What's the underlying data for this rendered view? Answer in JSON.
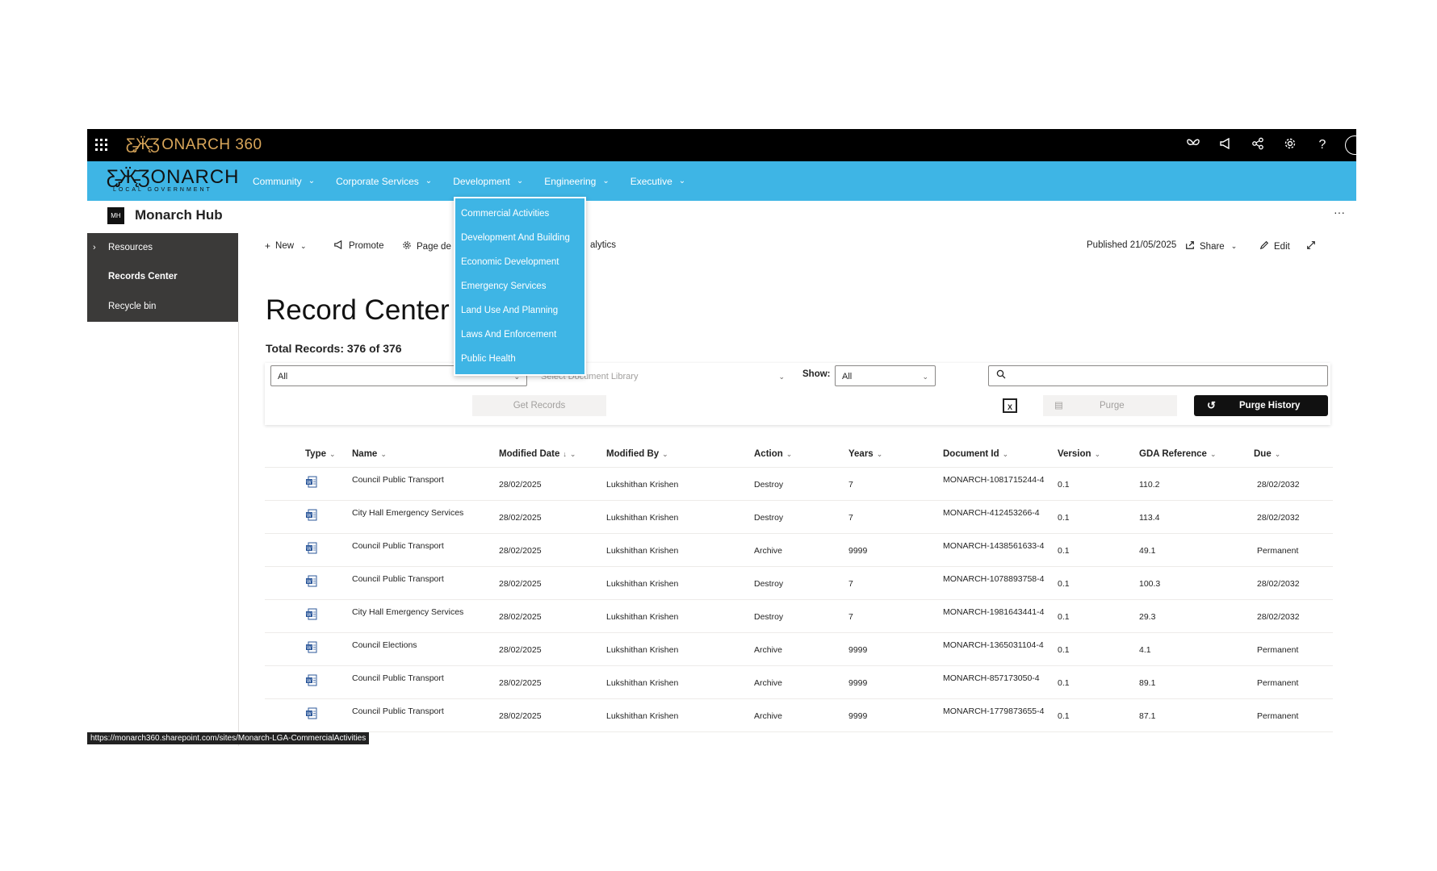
{
  "suitebar": {
    "brand": "ONARCH 360",
    "icons": [
      "monarch-butterfly-icon",
      "megaphone-icon",
      "share-network-icon",
      "gear-icon",
      "help-icon"
    ],
    "help_glyph": "?"
  },
  "hubnav": {
    "logo_word": "ONARCH",
    "logo_sub": "LOCAL GOVERNMENT",
    "items": [
      {
        "label": "Community"
      },
      {
        "label": "Corporate Services"
      },
      {
        "label": "Development"
      },
      {
        "label": "Engineering"
      },
      {
        "label": "Executive"
      }
    ],
    "dropdown": [
      {
        "label": "Commercial Activities"
      },
      {
        "label": "Development And Building"
      },
      {
        "label": "Economic Development"
      },
      {
        "label": "Emergency Services"
      },
      {
        "label": "Land Use And Planning"
      },
      {
        "label": "Laws And Enforcement"
      },
      {
        "label": "Public Health"
      }
    ]
  },
  "site": {
    "badge": "MH",
    "title": "Monarch Hub",
    "more": "···"
  },
  "leftnav": {
    "items": [
      {
        "label": "Resources"
      },
      {
        "label": "Records Center"
      },
      {
        "label": "Recycle bin"
      }
    ]
  },
  "commandbar": {
    "new_label": "New",
    "promote_label": "Promote",
    "page_details_label": "Page de",
    "analytics_label": "alytics",
    "published_label": "Published 21/05/2025",
    "share_label": "Share",
    "edit_label": "Edit"
  },
  "page": {
    "title": "Record Center",
    "total_records": "Total Records: 376 of 376"
  },
  "filters": {
    "site_select": "All",
    "library_placeholder": "Select Document Library",
    "show_label": "Show:",
    "show_value": "All",
    "get_records_label": "Get Records",
    "excel_label": "X",
    "purge_label": "Purge",
    "purge_history_label": "Purge History"
  },
  "table": {
    "columns": [
      "Type",
      "Name",
      "Modified Date",
      "Modified By",
      "Action",
      "Years",
      "Document Id",
      "Version",
      "GDA Reference",
      "Due"
    ],
    "sort_indicator": "↓",
    "rows": [
      {
        "name": "Council Public Transport",
        "modified": "28/02/2025",
        "by": "Lukshithan Krishen",
        "action": "Destroy",
        "years": "7",
        "doc_id": "MONARCH-1081715244-4",
        "version": "0.1",
        "gda": "110.2",
        "due": "28/02/2032"
      },
      {
        "name": "City Hall Emergency Services",
        "modified": "28/02/2025",
        "by": "Lukshithan Krishen",
        "action": "Destroy",
        "years": "7",
        "doc_id": "MONARCH-412453266-4",
        "version": "0.1",
        "gda": "113.4",
        "due": "28/02/2032"
      },
      {
        "name": "Council Public Transport",
        "modified": "28/02/2025",
        "by": "Lukshithan Krishen",
        "action": "Archive",
        "years": "9999",
        "doc_id": "MONARCH-1438561633-4",
        "version": "0.1",
        "gda": "49.1",
        "due": "Permanent"
      },
      {
        "name": "Council Public Transport",
        "modified": "28/02/2025",
        "by": "Lukshithan Krishen",
        "action": "Destroy",
        "years": "7",
        "doc_id": "MONARCH-1078893758-4",
        "version": "0.1",
        "gda": "100.3",
        "due": "28/02/2032"
      },
      {
        "name": "City Hall Emergency Services",
        "modified": "28/02/2025",
        "by": "Lukshithan Krishen",
        "action": "Destroy",
        "years": "7",
        "doc_id": "MONARCH-1981643441-4",
        "version": "0.1",
        "gda": "29.3",
        "due": "28/02/2032"
      },
      {
        "name": "Council Elections",
        "modified": "28/02/2025",
        "by": "Lukshithan Krishen",
        "action": "Archive",
        "years": "9999",
        "doc_id": "MONARCH-1365031104-4",
        "version": "0.1",
        "gda": "4.1",
        "due": "Permanent"
      },
      {
        "name": "Council Public Transport",
        "modified": "28/02/2025",
        "by": "Lukshithan Krishen",
        "action": "Archive",
        "years": "9999",
        "doc_id": "MONARCH-857173050-4",
        "version": "0.1",
        "gda": "89.1",
        "due": "Permanent"
      },
      {
        "name": "Council Public Transport",
        "modified": "28/02/2025",
        "by": "Lukshithan Krishen",
        "action": "Archive",
        "years": "9999",
        "doc_id": "MONARCH-1779873655-4",
        "version": "0.1",
        "gda": "87.1",
        "due": "Permanent"
      }
    ]
  },
  "statusbar": {
    "url": "https://monarch360.sharepoint.com/sites/Monarch-LGA-CommercialActivities"
  },
  "colors": {
    "suitebar": "#000000",
    "hubnav": "#3eb5e5",
    "leftnav": "#3b3a39",
    "brand_gold": "#d9a65a",
    "word_icon": "#2b579a"
  }
}
